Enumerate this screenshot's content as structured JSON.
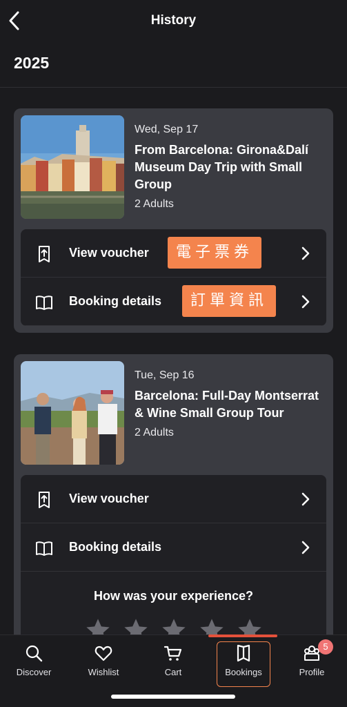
{
  "header": {
    "title": "History"
  },
  "year": "2025",
  "bookings": [
    {
      "date": "Wed, Sep 17",
      "title": "From Barcelona: Girona&Dalí Museum Day Trip with Small Group",
      "guests": "2 Adults",
      "actions": [
        {
          "label": "View voucher",
          "icon": "voucher-icon",
          "annotation": "電子票券"
        },
        {
          "label": "Booking details",
          "icon": "book-icon",
          "annotation": "訂單資訊"
        }
      ]
    },
    {
      "date": "Tue, Sep 16",
      "title": "Barcelona: Full-Day Montserrat & Wine Small Group Tour",
      "guests": "2 Adults",
      "actions": [
        {
          "label": "View voucher",
          "icon": "voucher-icon"
        },
        {
          "label": "Booking details",
          "icon": "book-icon"
        }
      ],
      "rating_prompt": "How was your experience?",
      "rating_stars": 5
    }
  ],
  "tabs": [
    {
      "label": "Discover",
      "icon": "search-icon"
    },
    {
      "label": "Wishlist",
      "icon": "heart-icon"
    },
    {
      "label": "Cart",
      "icon": "cart-icon"
    },
    {
      "label": "Bookings",
      "icon": "bookings-icon",
      "active": true
    },
    {
      "label": "Profile",
      "icon": "profile-icon",
      "badge": "5"
    }
  ],
  "colors": {
    "background": "#1b1b1e",
    "card": "#3a3b41",
    "action_panel": "#202024",
    "annotation": "#f4844d",
    "active_indicator": "#e4513b",
    "badge": "#f07474"
  }
}
